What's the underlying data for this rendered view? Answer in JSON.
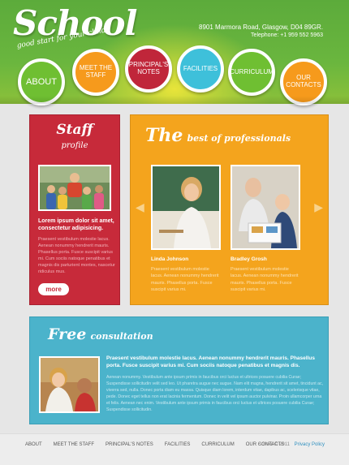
{
  "header": {
    "logo": "School",
    "tagline": "good start for your child",
    "address": "8901 Marmora Road, Glasgow,  D04 89GR.",
    "phone": "Telephone: +1 959 552 5963"
  },
  "nav": {
    "items": [
      "ABOUT",
      "MEET THE STAFF",
      "PRINCIPAL'S NOTES",
      "FACILITIES",
      "CURRICULUM",
      "OUR CONTACTS"
    ]
  },
  "staff": {
    "title": "Staff",
    "subtitle": "profile",
    "lead": "Lorem ipsum dolor sit amet, consectetur adipisicing.",
    "body": "Praesent vestibulum molestie lacus. Aenean nonummy hendrerit mauris. Phasellus porta. Fusce suscipit varius mi. Cum sociis natoque penatibus et magnis dis parturient montes, nascetur ridiculus mus.",
    "more": "more"
  },
  "best": {
    "title_big": "The",
    "title_rest": "best of professionals",
    "people": [
      {
        "name": "Linda Johnson",
        "text": "Praesent vestibulum molestie lacus. Aenean nonummy hendrerit mauris. Phasellus porta. Fusce suscipit varius mi."
      },
      {
        "name": "Bradley Grosh",
        "text": "Praesent vestibulum molestie lacus. Aenean nonummy hendrerit mauris. Phasellus porta. Fusce suscipit varius mi."
      }
    ]
  },
  "consult": {
    "title_big": "Free",
    "title_rest": "consultation",
    "lead": "Praesent vestibulum molestie lacus. Aenean nonummy hendrerit mauris. Phasellus porta. Fusce suscipit varius mi. Cum sociis natoque penatibus et magnis dis.",
    "body": "Aenean nonummy. Vestibulum ante ipsum primis in faucibus orci luctus et ultrices posuere cubilia Curae; Suspendisse sollicitudin velit sed leo. Ut pharetra augue nec augue. Nam elit magna, hendrerit sit amet, tincidunt ac, viverra sed, nulla. Donec porta diam eu massa. Quisque diam lorem, interdum vitae, dapibus ac, scelerisque vitae, pede. Donec eget tellus non erat lacinia fermentum. Donec in velit vel ipsum auctor pulvinar. Proin ullamcorper urna et felis. Aenean nec enim. Vestibulum ante ipsum primis in faucibus orci luctus et ultrices posuere cubilia Curae; Suspendisse sollicitudin."
  },
  "footer": {
    "items": [
      "ABOUT",
      "MEET THE STAFF",
      "PRINCIPAL'S NOTES",
      "FACILITIES",
      "CURRICULUM",
      "OUR CONTACTS"
    ],
    "copyright": "School © 2011",
    "privacy": "Privacy Policy"
  },
  "colors": {
    "green": "#6fbf32",
    "orange": "#f69a1c",
    "red": "#c0263a",
    "cyan": "#3ec0da",
    "staff_bg": "#c72a3a",
    "best_bg": "#f4a41d",
    "consult_bg": "#4bb3cb"
  },
  "icons": {
    "arrow_left": "◀",
    "arrow_right": "▶"
  }
}
